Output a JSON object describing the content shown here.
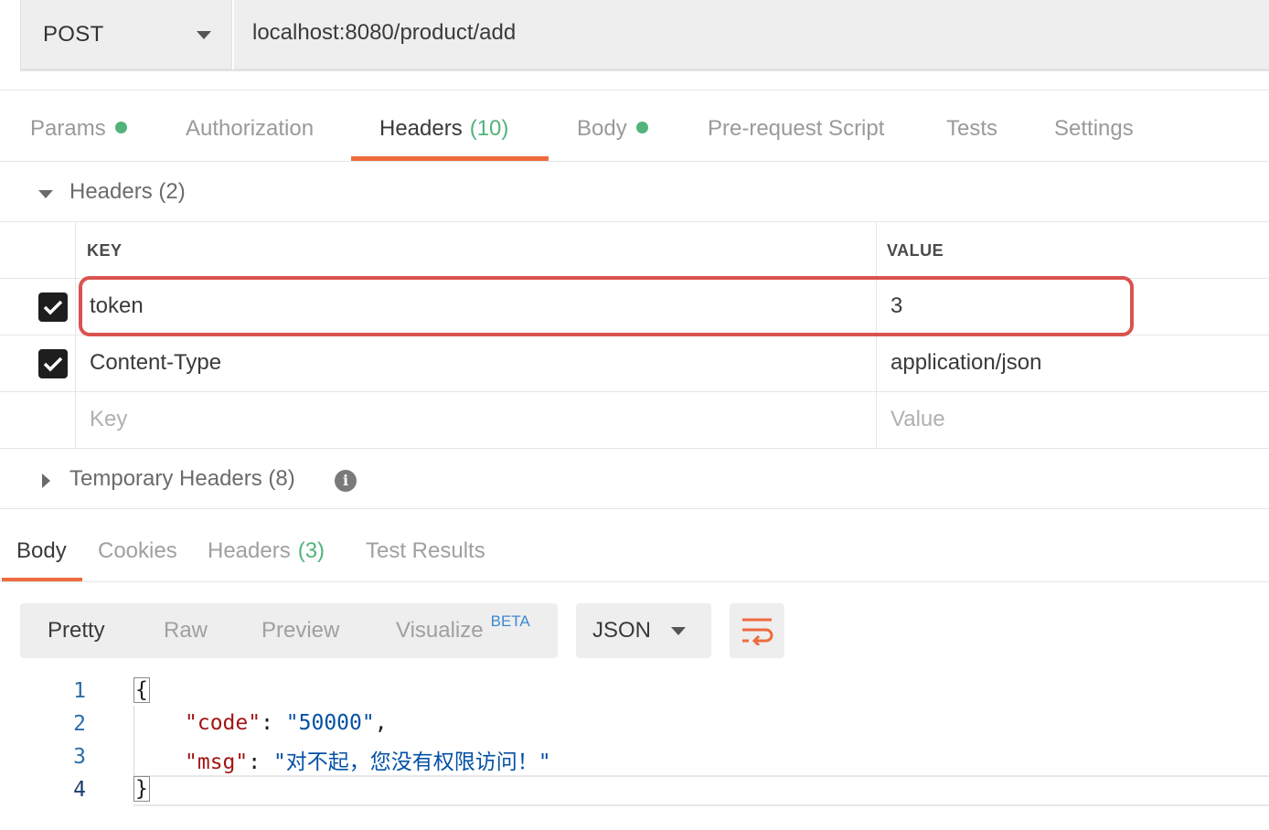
{
  "request": {
    "method": "POST",
    "url": "localhost:8080/product/add"
  },
  "request_tabs": {
    "params": "Params",
    "authorization": "Authorization",
    "headers": "Headers",
    "headers_count": "(10)",
    "body": "Body",
    "pre_request": "Pre-request Script",
    "tests": "Tests",
    "settings": "Settings"
  },
  "headers_section": {
    "title": "Headers",
    "count": "(2)",
    "col_key": "KEY",
    "col_value": "VALUE",
    "rows": [
      {
        "key": "token",
        "value": "3",
        "checked": true
      },
      {
        "key": "Content-Type",
        "value": "application/json",
        "checked": true
      }
    ],
    "placeholder_key": "Key",
    "placeholder_value": "Value",
    "temporary_title": "Temporary Headers",
    "temporary_count": "(8)"
  },
  "response_tabs": {
    "body": "Body",
    "cookies": "Cookies",
    "headers": "Headers",
    "headers_count": "(3)",
    "test_results": "Test Results"
  },
  "format_toolbar": {
    "pretty": "Pretty",
    "raw": "Raw",
    "preview": "Preview",
    "visualize": "Visualize",
    "beta": "BETA",
    "language": "JSON"
  },
  "code": {
    "line_numbers": [
      "1",
      "2",
      "3",
      "4"
    ],
    "open_brace": "{",
    "close_brace": "}",
    "code_key": "\"code\"",
    "code_value": "\"50000\"",
    "msg_key": "\"msg\"",
    "msg_value": "\"对不起，您没有权限访问！\""
  },
  "colors": {
    "accent": "#ef6b3d",
    "green": "#52b37b",
    "highlight": "#d9534f"
  }
}
